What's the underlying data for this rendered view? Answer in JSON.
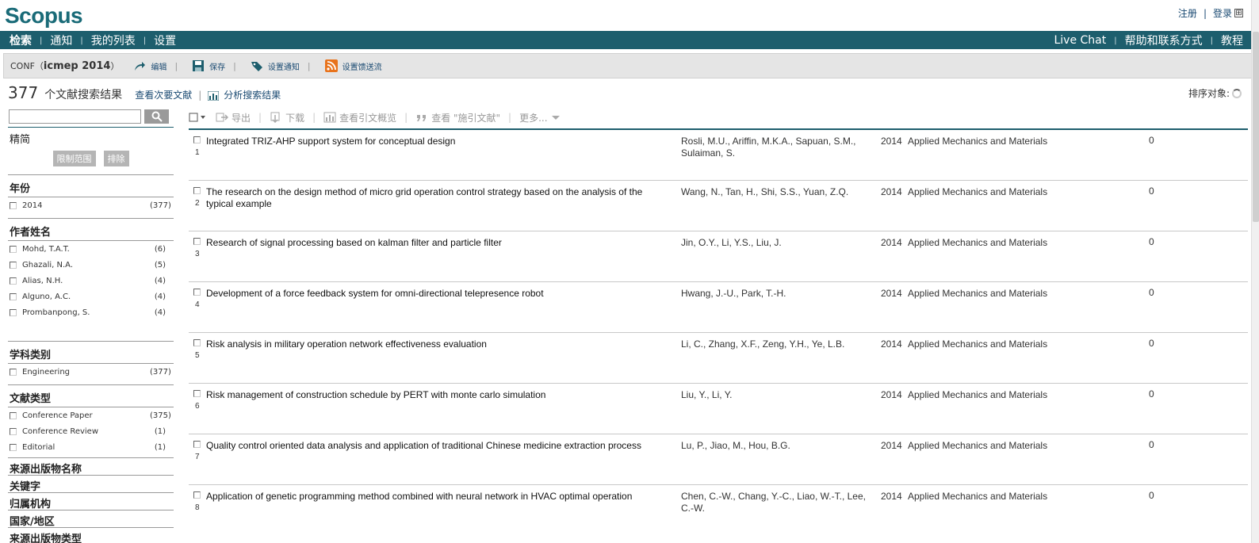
{
  "app": {
    "logo": "Scopus"
  },
  "top_links": {
    "register": "注册",
    "login": "登录",
    "login_icon": "⊞"
  },
  "nav": {
    "left": [
      "检索",
      "通知",
      "我的列表",
      "设置"
    ],
    "right": [
      "Live Chat",
      "帮助和联系方式",
      "教程"
    ]
  },
  "toolbar": {
    "conf_prefix": "CONF（",
    "conf_query": "icmep 2014",
    "conf_suffix": "）",
    "edit": "编辑",
    "save": "保存",
    "set_alert": "设置通知",
    "set_feed": "设置馈送流"
  },
  "results_head": {
    "count": "377",
    "label": "个文献搜索结果",
    "view_secondary": "查看次要文献",
    "analyze": "分析搜索结果",
    "sort_label": "排序对象:"
  },
  "search": {
    "placeholder": ""
  },
  "refine": {
    "title": "精简",
    "limit_button": "限制范围",
    "exclude_button": "排除",
    "year": {
      "title": "年份",
      "items": [
        {
          "label": "2014",
          "count": "(377)"
        }
      ]
    },
    "author": {
      "title": "作者姓名",
      "items": [
        {
          "label": "Mohd, T.A.T.",
          "count": "(6)"
        },
        {
          "label": "Ghazali, N.A.",
          "count": "(5)"
        },
        {
          "label": "Alias, N.H.",
          "count": "(4)"
        },
        {
          "label": "Alguno, A.C.",
          "count": "(4)"
        },
        {
          "label": "Prombanpong, S.",
          "count": "(4)"
        }
      ]
    },
    "subject": {
      "title": "学科类别",
      "items": [
        {
          "label": "Engineering",
          "count": "(377)"
        }
      ]
    },
    "doctype": {
      "title": "文献类型",
      "items": [
        {
          "label": "Conference Paper",
          "count": "(375)"
        },
        {
          "label": "Conference Review",
          "count": "(1)"
        },
        {
          "label": "Editorial",
          "count": "(1)"
        }
      ]
    },
    "collapsed": [
      "来源出版物名称",
      "关键字",
      "归属机构",
      "国家/地区",
      "来源出版物类型"
    ]
  },
  "actions": {
    "export": "导出",
    "download": "下载",
    "citation_overview": "查看引文概览",
    "cited_by": "查看 \"施引文献\"",
    "more": "更多..."
  },
  "results": [
    {
      "num": "1",
      "title": "Integrated TRIZ-AHP support system for conceptual design",
      "authors": "Rosli, M.U., Ariffin, M.K.A., Sapuan, S.M., Sulaiman, S.",
      "year": "2014",
      "source": "Applied Mechanics and Materials",
      "cites": "0"
    },
    {
      "num": "2",
      "title": "The research on the design method of micro grid operation control strategy based on the analysis of the typical example",
      "authors": "Wang, N., Tan, H., Shi, S.S., Yuan, Z.Q.",
      "year": "2014",
      "source": "Applied Mechanics and Materials",
      "cites": "0"
    },
    {
      "num": "3",
      "title": "Research of signal processing based on kalman filter and particle filter",
      "authors": "Jin, O.Y., Li, Y.S., Liu, J.",
      "year": "2014",
      "source": "Applied Mechanics and Materials",
      "cites": "0"
    },
    {
      "num": "4",
      "title": "Development of a force feedback system for omni-directional telepresence robot",
      "authors": "Hwang, J.-U., Park, T.-H.",
      "year": "2014",
      "source": "Applied Mechanics and Materials",
      "cites": "0"
    },
    {
      "num": "5",
      "title": "Risk analysis in military operation network effectiveness evaluation",
      "authors": "Li, C., Zhang, X.F., Zeng, Y.H., Ye, L.B.",
      "year": "2014",
      "source": "Applied Mechanics and Materials",
      "cites": "0"
    },
    {
      "num": "6",
      "title": "Risk management of construction schedule by PERT with monte carlo simulation",
      "authors": "Liu, Y., Li, Y.",
      "year": "2014",
      "source": "Applied Mechanics and Materials",
      "cites": "0"
    },
    {
      "num": "7",
      "title": "Quality control oriented data analysis and application of traditional Chinese medicine extraction process",
      "authors": "Lu, P., Jiao, M., Hou, B.G.",
      "year": "2014",
      "source": "Applied Mechanics and Materials",
      "cites": "0"
    },
    {
      "num": "8",
      "title": "Application of genetic programming method combined with neural network in HVAC optimal operation",
      "authors": "Chen, C.-W., Chang, Y.-C., Liao, W.-T., Lee, C.-W.",
      "year": "2014",
      "source": "Applied Mechanics and Materials",
      "cites": "0"
    }
  ],
  "colors": {
    "brand": "#1d5e6d",
    "link": "#1a4a72",
    "logo": "#1a6b78"
  }
}
